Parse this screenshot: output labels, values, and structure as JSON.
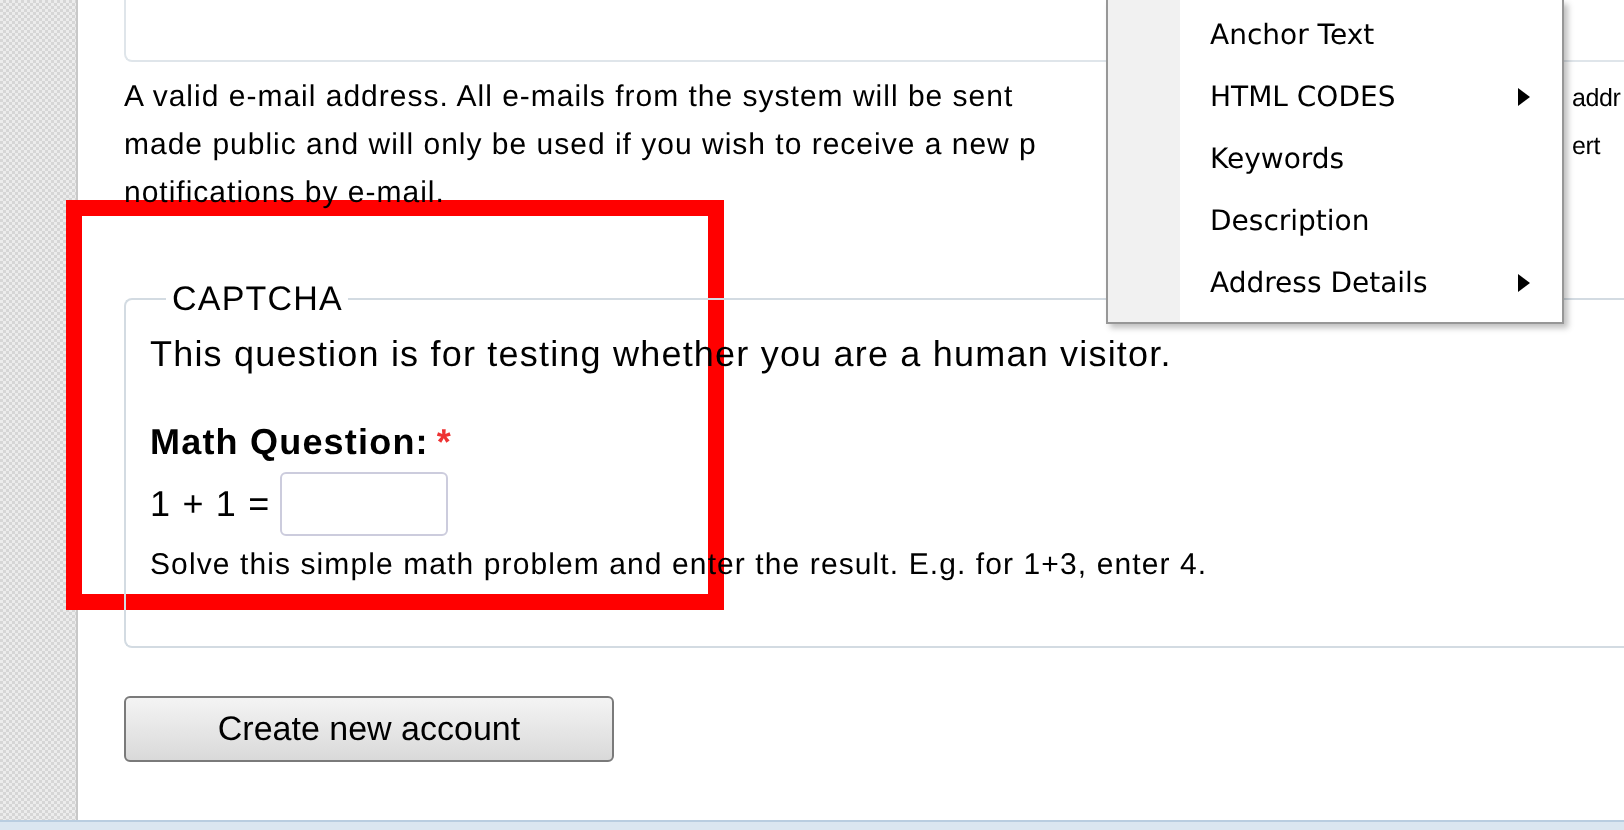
{
  "email_help": {
    "lines": [
      "A valid e-mail address. All e-mails from the system will be sent",
      "made public and will only be used if you wish to receive a new p",
      "notifications by e-mail."
    ],
    "right_fragments": [
      "addr",
      "ert"
    ]
  },
  "context_menu": {
    "items": [
      {
        "label": "Anchor Text",
        "submenu": false
      },
      {
        "label": "HTML CODES",
        "submenu": true
      },
      {
        "label": "Keywords",
        "submenu": false
      },
      {
        "label": "Description",
        "submenu": false
      },
      {
        "label": "Address Details",
        "submenu": true
      }
    ]
  },
  "captcha": {
    "legend": "CAPTCHA",
    "intro": "This question is for testing whether you are a human visitor.",
    "question_label": "Math Question:",
    "required_mark": "*",
    "equation": "1 + 1 =",
    "hint": "Solve this simple math problem and enter the result. E.g. for 1+3, enter 4."
  },
  "submit_button": "Create new account"
}
